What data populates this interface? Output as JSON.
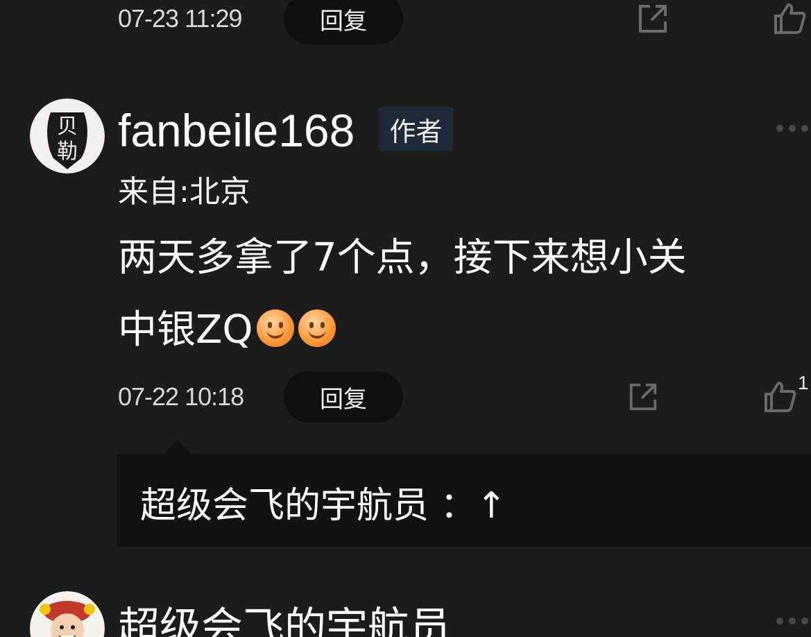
{
  "prev_comment": {
    "time": "07-23 11:29",
    "reply_label": "回复"
  },
  "comment": {
    "username": "fanbeile168",
    "author_badge": "作者",
    "location": "来自:北京",
    "line1": "两天多拿了7个点，接下来想小关",
    "line2": "中银ZQ",
    "time": "07-22 10:18",
    "reply_label": "回复",
    "like_count": "1",
    "avatar_text": "贝勒"
  },
  "quote": {
    "text": "超级会飞的宇航员 ：↑"
  },
  "next_comment": {
    "username": "超级会飞的宇航员"
  },
  "icons": [
    "share-icon",
    "thumbs-up-icon",
    "more-icon",
    "smile-emoji"
  ],
  "colors": {
    "background": "#1c1c1c",
    "reply_button": "#0f0f0f",
    "quote_box": "#121212",
    "author_badge": "#1f2937",
    "emoji": "#ff9a3c"
  }
}
